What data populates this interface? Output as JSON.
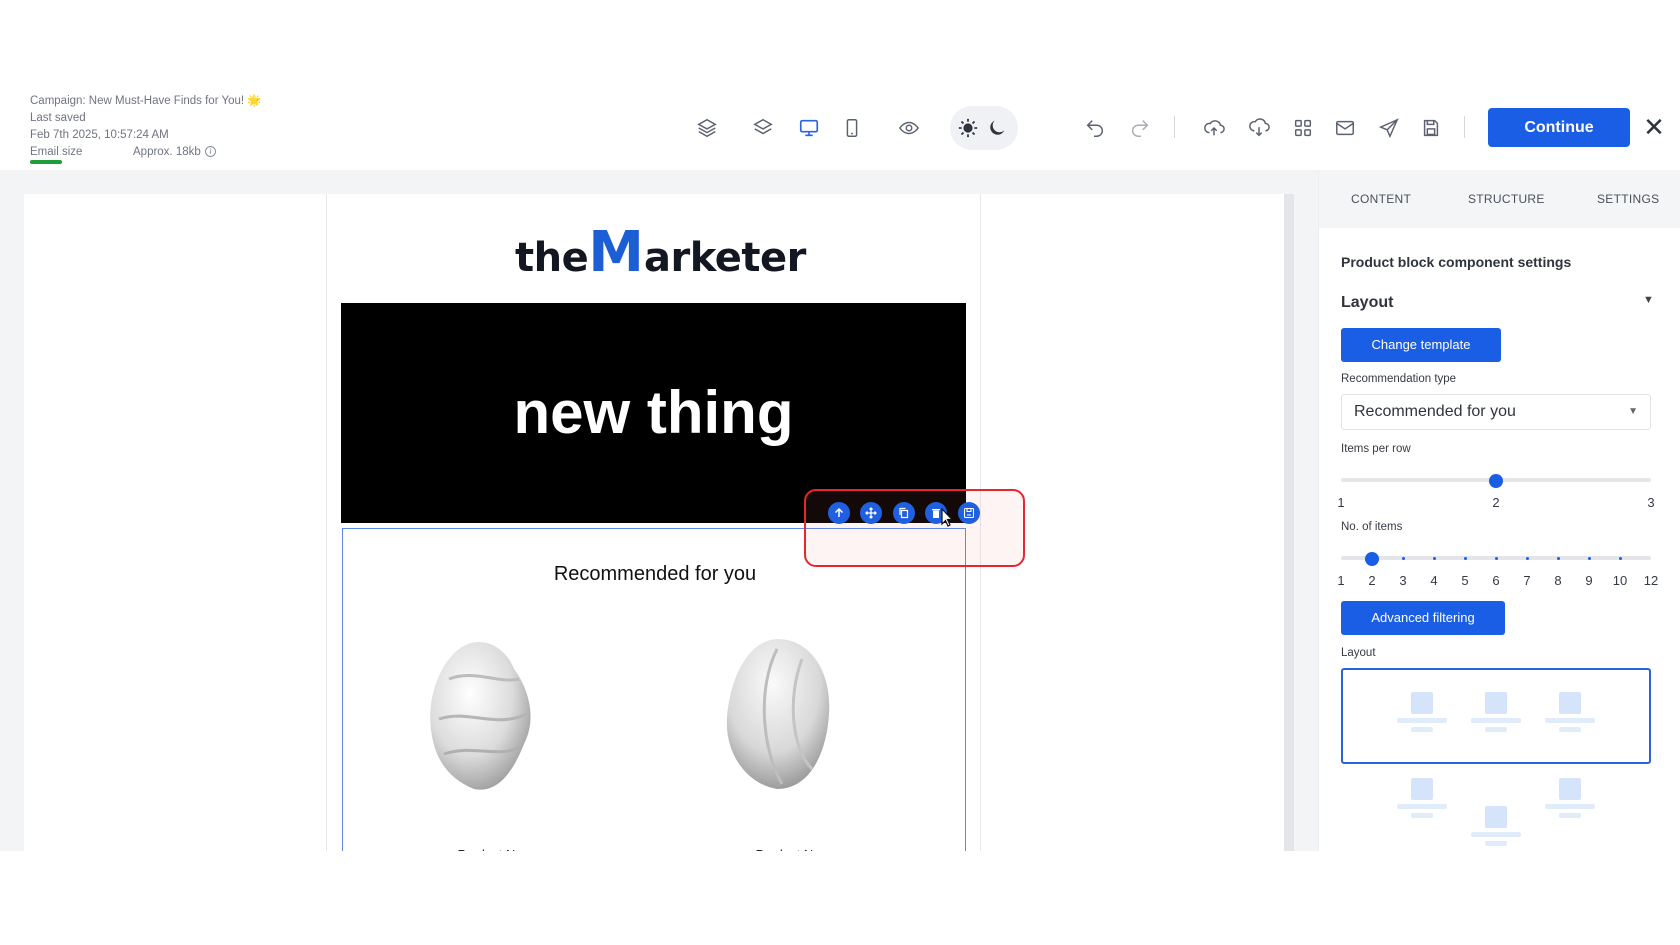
{
  "header": {
    "campaign_label": "Campaign: New Must-Have Finds for You! 🌟",
    "last_saved_label": "Last saved",
    "last_saved_date": "Feb 7th 2025, 10:57:24 AM",
    "email_size_label": "Email size",
    "email_size_value": "Approx. 18kb",
    "continue_label": "Continue",
    "close_label": "✕"
  },
  "toolbar": {
    "icons": [
      "layers-stack-icon",
      "layers-icon",
      "desktop-icon",
      "mobile-icon",
      "preview-eye-icon",
      "light-mode-icon",
      "dark-mode-icon",
      "undo-icon",
      "redo-icon",
      "upload-icon",
      "download-icon",
      "apps-grid-icon",
      "email-icon",
      "send-icon",
      "save-icon"
    ],
    "active_view": "desktop"
  },
  "email": {
    "logo_the": "the",
    "logo_m": "M",
    "logo_rest": "arketer",
    "hero_text": "new thing",
    "product_block_title": "Recommended for you",
    "products": [
      {
        "name": "Product Name"
      },
      {
        "name": "Product Name"
      }
    ]
  },
  "block_actions": [
    "move-up-icon",
    "drag-move-icon",
    "duplicate-icon",
    "delete-icon",
    "save-block-icon"
  ],
  "panel": {
    "tabs": [
      "CONTENT",
      "STRUCTURE",
      "SETTINGS"
    ],
    "heading": "Product block component settings",
    "section_title": "Layout",
    "change_template_label": "Change template",
    "rec_type_label": "Recommendation type",
    "rec_type_value": "Recommended for you",
    "items_per_row_label": "Items per row",
    "items_per_row_ticks": [
      "1",
      "2",
      "3"
    ],
    "items_per_row_value": 2,
    "no_items_label": "No. of items",
    "no_items_ticks": [
      "1",
      "2",
      "3",
      "4",
      "5",
      "6",
      "7",
      "8",
      "9",
      "10",
      "12"
    ],
    "no_items_value": 2,
    "advanced_filtering_label": "Advanced filtering",
    "layout_label": "Layout"
  },
  "colors": {
    "accent": "#1a5ee6",
    "highlight_red": "#e8262d"
  }
}
